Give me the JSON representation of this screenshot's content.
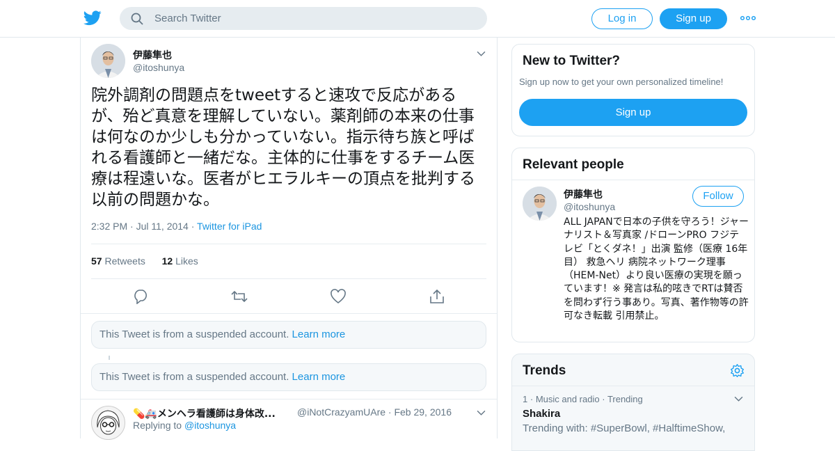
{
  "header": {
    "search_placeholder": "Search Twitter",
    "login_label": "Log in",
    "signup_label": "Sign up"
  },
  "tweet": {
    "author_name": "伊藤隼也",
    "author_handle": "@itoshunya",
    "text": "院外調剤の問題点をtweetすると速攻で反応があるが、殆ど真意を理解していない。薬剤師の本来の仕事は何なのか少しも分かっていない。指示待ち族と呼ばれる看護師と一緒だな。主体的に仕事をするチーム医療は程遠いな。医者がヒエラルキーの頂点を批判する以前の問題かな。",
    "time": "2:32 PM",
    "date": "Jul 11, 2014",
    "source": "Twitter for iPad",
    "retweets_count": "57",
    "retweets_label": "Retweets",
    "likes_count": "12",
    "likes_label": "Likes"
  },
  "notices": [
    {
      "text": "This Tweet is from a suspended account.",
      "link": "Learn more"
    },
    {
      "text": "This Tweet is from a suspended account.",
      "link": "Learn more"
    }
  ],
  "reply": {
    "author_name": "💊🚑メンヘラ看護師は身体改...",
    "author_handle": "@iNotCrazyamUAre",
    "date": "Feb 29, 2016",
    "replying_label": "Replying to",
    "replying_handle": "@itoshunya"
  },
  "new_to_twitter": {
    "title": "New to Twitter?",
    "subtitle": "Sign up now to get your own personalized timeline!",
    "button": "Sign up"
  },
  "relevant_people": {
    "title": "Relevant people",
    "name": "伊藤隼也",
    "handle": "@itoshunya",
    "follow_label": "Follow",
    "bio": "ALL JAPANで日本の子供を守ろう！ジャーナリスト＆写真家 /ドローンPRO フジテレビ「とくダネ！」出演 監修（医療 16年目） 救急ヘリ 病院ネットワーク理事（HEM-Net）より良い医療の実現を願っています！※ 発言は私的呟きでRTは賛否を問わず行う事あり。写真、著作物等の許可なき転載 引用禁止。"
  },
  "trends": {
    "title": "Trends",
    "items": [
      {
        "rank": "1",
        "context": "Music and radio",
        "status": "Trending",
        "name": "Shakira",
        "with": "Trending with: #SuperBowl, #HalftimeShow,"
      }
    ]
  },
  "colors": {
    "accent": "#1da1f2",
    "link": "#1b95e0",
    "muted": "#657786",
    "border": "#e1e8ed"
  },
  "icons": [
    "twitter-bird-icon",
    "search-icon",
    "more-dots-icon",
    "chevron-down-icon",
    "reply-icon",
    "retweet-icon",
    "like-heart-icon",
    "share-icon",
    "gear-icon"
  ]
}
